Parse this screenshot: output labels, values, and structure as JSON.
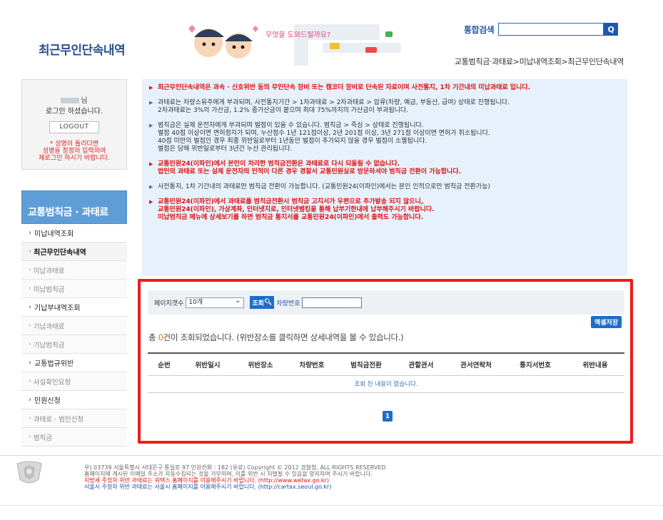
{
  "header": {
    "title": "최근무인단속내역",
    "banner_text": "무엇을 도와드릴까요?",
    "search_label": "통합검색",
    "search_value": "",
    "search_button": "Q",
    "breadcrumb": "교통범칙금·과태료>미납내역조회>최근무인단속내역"
  },
  "login": {
    "name_suffix": "님",
    "message": "로그인 하셨습니다.",
    "logout_label": "LOGOUT",
    "warning_line1": "* 성명이 틀리다면",
    "warning_line2": "성명을 정정하 입력하여",
    "warning_line3": "재로그인 하시기 바랍니다."
  },
  "nav": {
    "heading": "교통범칙금 · 과태료",
    "items": [
      {
        "label": "미납내역조회",
        "level": 1
      },
      {
        "label": "최근무인단속내역",
        "level": 2,
        "active": true
      },
      {
        "label": "미납과태료",
        "level": 2
      },
      {
        "label": "미납범칙금",
        "level": 2
      },
      {
        "label": "기납부내역조회",
        "level": 1
      },
      {
        "label": "기납과태료",
        "level": 2
      },
      {
        "label": "기납범칙금",
        "level": 2
      },
      {
        "label": "교통법규위반",
        "level": 1
      },
      {
        "label": "사실확인요청",
        "level": 2
      },
      {
        "label": "민원신청",
        "level": 1
      },
      {
        "label": "과태료 · 범인신청",
        "level": 2
      },
      {
        "label": "범칙금",
        "level": 2
      }
    ]
  },
  "info": {
    "p1": "최근무인단속내역은 과속 · 신호위반 등의 무인단속 장비 또는 캠코더 장비로 단속된 자료이며 사전통지, 1차 기간내의 미납과태료 입니다.",
    "p2a": "과태료는 차량소유주에게 부과되며, 사전통지기간 > 1차과태료 > 2차과태료 > 압류(차량, 예금, 부동산, 급여) 상태로 진행됩니다.",
    "p2b": "2차과태료는 3%의 가산금, 1.2% 중가산금이 붙으며 최대 75%까지의 가산금이 부과됩니다.",
    "p3a": "범칙금은 실제 운전자에게 부과되며 벌점이 있을 수 있습니다. 범칙금 > 즉심 > 상태로 진행됩니다.",
    "p3b": "벌점 40점 이상이면 면허정지가 되며, 누산점수 1년 121점이상, 2년 201점 이상, 3년 271점 이상이면 면허가 취소됩니다.",
    "p3c": "40점 미만의 벌점인 경우 최종 위반일로부터 1년동안 벌점이 추가되지 않을 경우 벌점이 소멸됩니다.",
    "p3d": "벌점은 당해 위반일로부터 3년간 누산 관리됩니다.",
    "p4a": "교통민원24(이파인)에서 본인이 처리한 범칙금전환은 과태료로 다시 되돌릴 수 없습니다.",
    "p4b": "법인의 과태료 또는 실제 운전자의 인적이 다른 경우 경찰서 교통민원실로 방문하셔야 범칙금 전환이 가능합니다.",
    "p5": "사전통지, 1차 기간내의 과태료만 범칙금 전환이 가능합니다. (교통민원24(이파인)에서는 본인 인적으로만 범칙금 전환가능)",
    "p6a": "교통민원24(이파인)에서 과태료를 범칙금전환시 범칙금 고지서가 우편으로 추가발송 되지 않으니,",
    "p6b": "교통민원24(이파인), 가상계좌, 인터넷지로, 인터넷뱅킹을 통해 납부기한내에 납부해주시기 바랍니다.",
    "p6c": "미납범칙금 메뉴에 상세보기를 하면 범칙금 통지서를 교통민원24(이파인)에서 출력도 가능합니다."
  },
  "results": {
    "page_size_label": "페이지갯수",
    "page_size_value": "10개",
    "search_label": "조회",
    "plate_label": "차량번호",
    "plate_value": "",
    "excel_label": "엑셀저장",
    "total_prefix": "총 ",
    "total_count": "0",
    "total_suffix": "건이 조회되었습니다. (위반장소를 클릭하면 상세내역을 볼 수 있습니다.)",
    "columns": [
      "순번",
      "위반일시",
      "위반장소",
      "차량번호",
      "범칙금전환",
      "관할관서",
      "관서연락처",
      "통지서번호",
      "위반내용"
    ],
    "empty_message": "조회 된 내용이 없습니다.",
    "current_page": "1"
  },
  "footer": {
    "line1": "우) 03739 서울특별시 서대문구 통일로 97  민원전화 : 182 (유료)      Copyright © 2012 경찰청, ALL RIGHTS RESERVED",
    "line2": "홈페이지에 게시된 이메일 주소가 자동수집되는 것을 거부하며, 이를 위반 시 처벌될 수 있음을 양지하여 주시기 바랍니다.",
    "line3": "지방세 주정차 위반 과태료는 위택스 홈페이지를 이용해주시기 바랍니다. (http://www.wetax.go.kr)",
    "line4": "서울시 주정차 위반 과태료는 서울시 홈페이지를 이용해주시기 바랍니다. (http://cartax.seoul.go.kr)"
  },
  "colors": {
    "accent": "#1c6ec8",
    "nav_head": "#5f9dd6",
    "highlight_border": "#ef1b1b",
    "warning": "#e01010"
  }
}
